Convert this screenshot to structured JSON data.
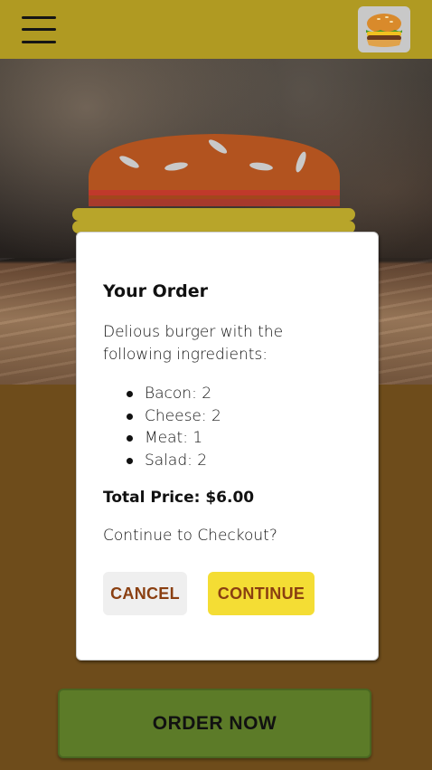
{
  "toolbar": {
    "menu_icon": "hamburger-menu-icon",
    "logo_icon": "burger-logo-icon"
  },
  "burger_preview": {
    "icon": "burger-illustration"
  },
  "modal": {
    "title": "Your Order",
    "description": "Delious burger with the following ingredients:",
    "ingredients": [
      {
        "label": "Bacon: 2"
      },
      {
        "label": "Cheese: 2"
      },
      {
        "label": "Meat: 1"
      },
      {
        "label": "Salad: 2"
      }
    ],
    "total_price": "Total Price: $6.00",
    "question": "Continue to Checkout?",
    "cancel_label": "CANCEL",
    "continue_label": "CONTINUE"
  },
  "order_now_label": "ORDER NOW",
  "colors": {
    "toolbar": "#b09a22",
    "background": "#6e4c1b",
    "order_button": "#5c7b28",
    "continue_button": "#f4dd34",
    "cancel_button": "#efefef",
    "button_text": "#8a3f11"
  }
}
